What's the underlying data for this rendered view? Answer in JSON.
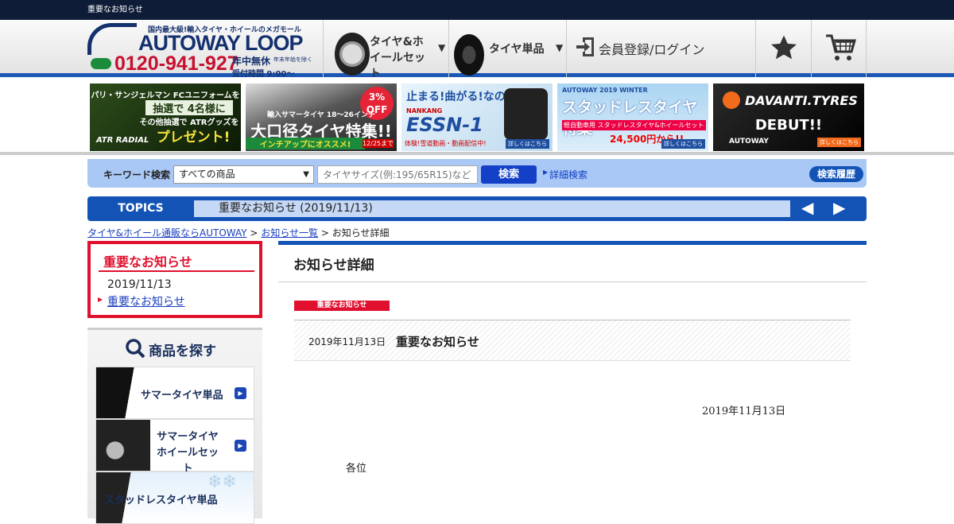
{
  "topbar": {
    "text": "重要なお知らせ"
  },
  "logo": {
    "slogan": "国内最大級!輸入タイヤ・ホイールのメガモール",
    "brand": "AUTOWAY LOOP",
    "phone": "0120-941-927",
    "open": "年中無休",
    "hours": "年末年始を除く",
    "hours2": "受付時間 9:00〜18:00"
  },
  "nav": {
    "tire_wheel": "タイヤ&ホイールセット",
    "tire_single": "タイヤ単品",
    "login": "会員登録/ログイン"
  },
  "banners": [
    {
      "line1": "パリ・サンジェルマン FCユニフォームを",
      "line2": "抽選で 4名様に",
      "line3": "その他抽選で ATRグッズを",
      "line4": "プレゼント!",
      "brand": "ATR RADIAL"
    },
    {
      "badge": "3% OFF",
      "line1": "輸入サマータイヤ 18〜26インチ",
      "line2": "大口径タイヤ特集!!",
      "line3": "インチアップにオススメ!",
      "date": "12/25まで"
    },
    {
      "line1": "止まる!曲がる!なのに格安!!",
      "brand": "NANKANG",
      "model": "ESSN-1",
      "line2": "体験!雪道動画・動画配信中!",
      "more": "詳しくはこちら"
    },
    {
      "line1": "AUTOWAY 2019 WINTER",
      "line2": "スタッドレスタイヤ特集",
      "line3": "軽自動車用 スタッドレスタイヤ&ホイールセット",
      "price": "24,500円から!!",
      "more": "詳しくはこちら"
    },
    {
      "brand": "DAVANTI.TYRES",
      "line2": "DEBUT!!",
      "shop": "AUTOWAY",
      "more": "詳しくはこちら"
    }
  ],
  "search": {
    "label": "キーワード検索",
    "category": "すべての商品",
    "placeholder": "タイヤサイズ(例:195/65R15)など",
    "button": "検索",
    "advanced": "詳細検索",
    "history": "検索履歴"
  },
  "topics": {
    "label": "TOPICS",
    "text": "重要なお知らせ (2019/11/13)"
  },
  "breadcrumb": {
    "home": "タイヤ&ホイール通販ならAUTOWAY",
    "list": "お知らせ一覧",
    "current": "お知らせ詳細",
    "sep": ">"
  },
  "side": {
    "notice_title": "重要なお知らせ",
    "notice_date": "2019/11/13",
    "notice_link": "重要なお知らせ",
    "find_title": "商品を探す",
    "items": [
      "サマータイヤ単品",
      "サマータイヤ\nホイールセット",
      "スタッドレスタイヤ単品"
    ]
  },
  "main": {
    "title": "お知らせ詳細",
    "tag": "重要なお知らせ",
    "date": "2019年11月13日",
    "heading": "重要なお知らせ",
    "body_date": "2019年11月13日",
    "greeting": "各位"
  },
  "colors": {
    "navy": "#0e1c38",
    "blue": "#1253b5",
    "red": "#e0102e"
  }
}
